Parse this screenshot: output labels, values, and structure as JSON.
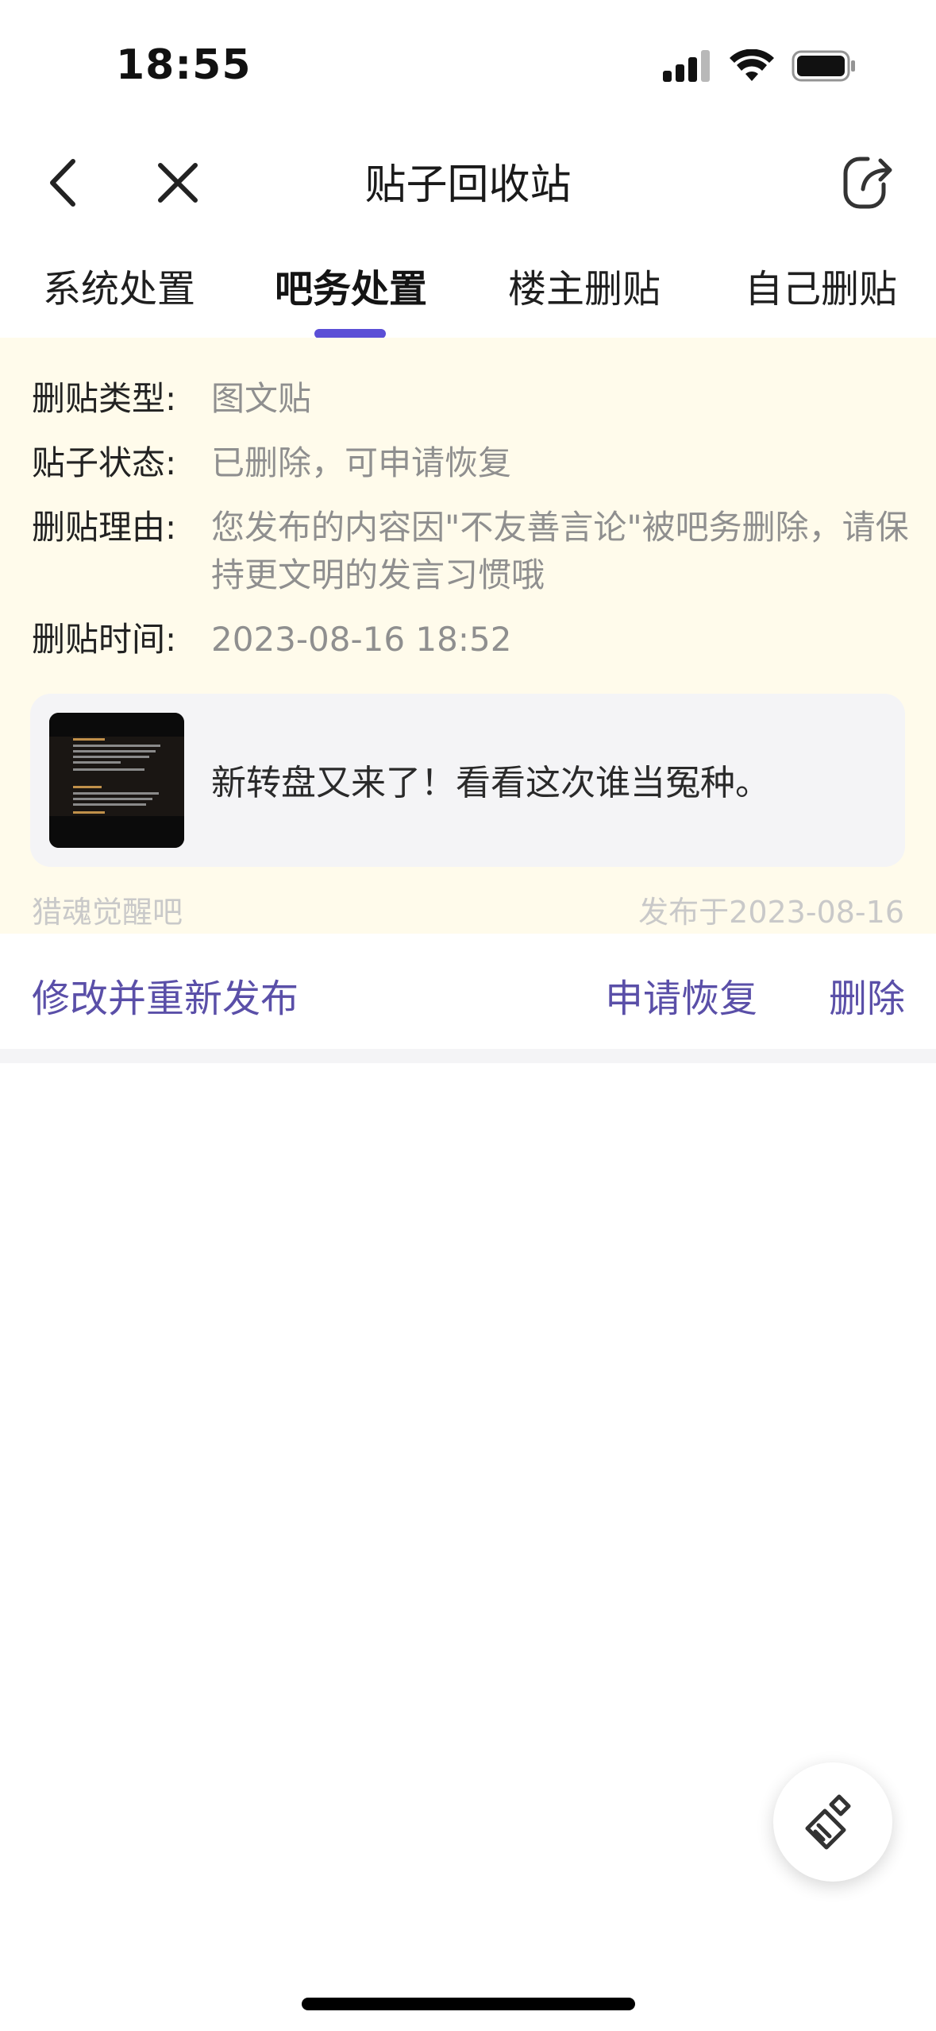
{
  "status_bar": {
    "time": "18:55",
    "icons": [
      "cellular-signal-icon",
      "wifi-icon",
      "battery-icon"
    ]
  },
  "navbar": {
    "title": "贴子回收站",
    "icons": [
      "back-icon",
      "close-icon",
      "share-icon"
    ]
  },
  "tabs": [
    {
      "label": "系统处置",
      "active": false
    },
    {
      "label": "吧务处置",
      "active": true
    },
    {
      "label": "楼主删贴",
      "active": false
    },
    {
      "label": "自己删贴",
      "active": false
    }
  ],
  "details": {
    "type_label": "删贴类型:",
    "type_value": "图文贴",
    "status_label": "贴子状态:",
    "status_value": "已删除，可申请恢复",
    "reason_label": "删贴理由:",
    "reason_value": "您发布的内容因\"不友善言论\"被吧务删除，请保持更文明的发言习惯哦",
    "time_label": "删贴时间:",
    "time_value": "2023-08-16 18:52"
  },
  "post": {
    "title": "新转盘又来了！看看这次谁当冤种。",
    "forum": "猎魂觉醒吧",
    "published": "发布于2023-08-16"
  },
  "actions": {
    "edit_republish": "修改并重新发布",
    "apply_restore": "申请恢复",
    "delete": "删除"
  },
  "fab_icon": "broom-clean-icon",
  "colors": {
    "accent": "#5b4fd6",
    "action_text": "#5a4fa8",
    "panel_bg": "#fffbeb",
    "muted_text": "#8f8f8f"
  }
}
